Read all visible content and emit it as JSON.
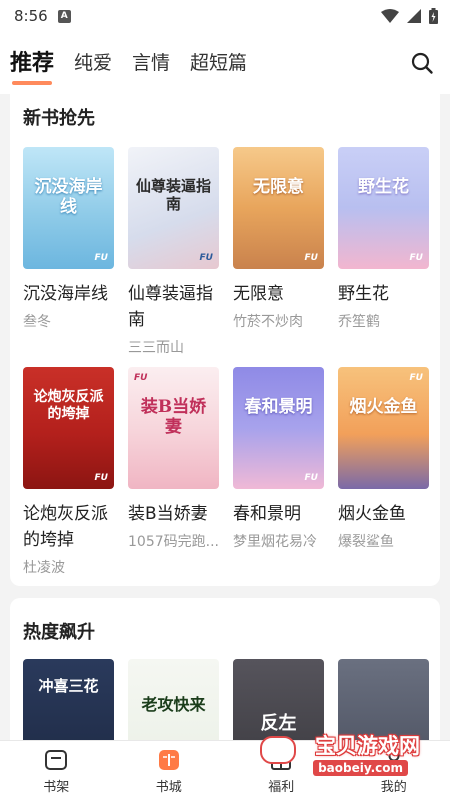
{
  "status_bar": {
    "time": "8:56",
    "app_icon_letter": "A"
  },
  "top_tabs": [
    {
      "label": "推荐",
      "active": true
    },
    {
      "label": "纯爱",
      "active": false
    },
    {
      "label": "言情",
      "active": false
    },
    {
      "label": "超短篇",
      "active": false
    }
  ],
  "new_books": {
    "title": "新书抢先",
    "books": [
      {
        "title": "沉没海岸线",
        "author": "叁冬",
        "cover_text": "沉没海岸线",
        "cover_bg": "#8fcbe8",
        "cover_fg": "#ffffff"
      },
      {
        "title": "仙尊装逼指南",
        "author": "三三而山",
        "cover_text": "仙尊装逼指南",
        "cover_bg": "#dfe3ec",
        "cover_fg": "#2b2b2b"
      },
      {
        "title": "无限意",
        "author": "竹菸不炒肉",
        "cover_text": "无限意",
        "cover_bg": "#e8a55c",
        "cover_fg": "#ffffff"
      },
      {
        "title": "野生花",
        "author": "乔笙鹤",
        "cover_text": "野生花",
        "cover_bg": "#b8bff0",
        "cover_fg": "#ffffff"
      },
      {
        "title": "论炮灰反派的垮掉",
        "author": "杜凌波",
        "cover_text": "论炮灰反派的垮掉",
        "cover_bg": "#b3201c",
        "cover_fg": "#ffffff"
      },
      {
        "title": "装B当娇妻",
        "author": "1057码完跑...",
        "cover_text": "装B当娇妻",
        "cover_bg": "#f7d6dc",
        "cover_fg": "#c0305a"
      },
      {
        "title": "春和景明",
        "author": "梦里烟花易冷",
        "cover_text": "春和景明",
        "cover_bg": "#a7a2ec",
        "cover_fg": "#ffffff"
      },
      {
        "title": "烟火金鱼",
        "author": "爆裂鲨鱼",
        "cover_text": "烟火金鱼",
        "cover_bg": "#f2a05a",
        "cover_fg": "#ffffff"
      }
    ]
  },
  "hot_books": {
    "title": "热度飙升",
    "books": [
      {
        "cover_text": "冲喜三花",
        "cover_bg": "#1e2a44",
        "cover_fg": "#ffffff"
      },
      {
        "cover_text": "老攻快来",
        "cover_bg": "#eaf0e6",
        "cover_fg": "#1b3d1b"
      },
      {
        "cover_text": "反左",
        "cover_bg": "#3b3a3f",
        "cover_fg": "#ffffff"
      },
      {
        "cover_text": "",
        "cover_bg": "#4a4f5e",
        "cover_fg": "#ffffff"
      }
    ]
  },
  "bottom_nav": [
    {
      "label": "书架",
      "icon": "bookshelf-icon",
      "active": false
    },
    {
      "label": "书城",
      "icon": "bookstore-icon",
      "active": true
    },
    {
      "label": "福利",
      "icon": "gift-icon",
      "active": false
    },
    {
      "label": "我的",
      "icon": "profile-icon",
      "active": false
    }
  ],
  "watermark": {
    "text": "宝贝游戏网",
    "url": "baobeiy.com"
  },
  "colors": {
    "accent": "#ff8a5c",
    "active_nav": "#ff7a45"
  }
}
